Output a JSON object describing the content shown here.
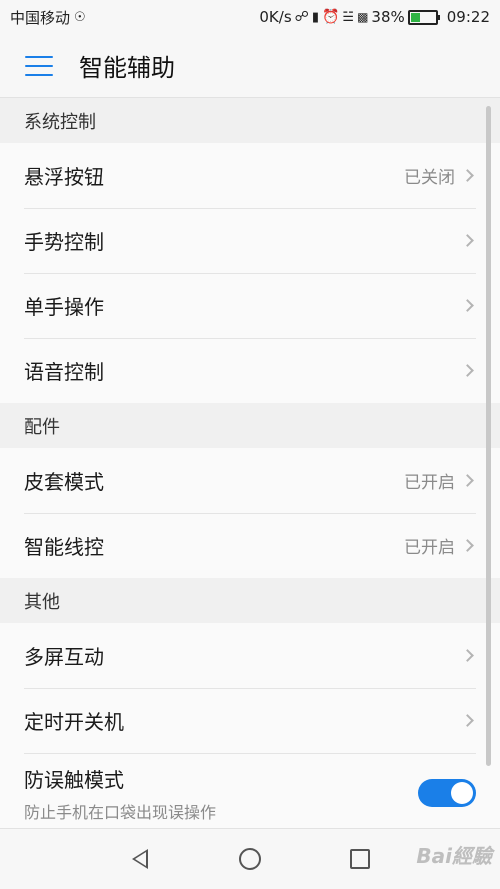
{
  "status_bar": {
    "carrier": "中国移动",
    "network_speed": "0K/s",
    "battery_percent": "38%",
    "battery_level": 0.38,
    "time": "09:22",
    "icons": [
      "hd-icon",
      "headphone-icon",
      "vibrate-icon",
      "alarm-icon",
      "wifi-icon",
      "4g-signal-icon",
      "battery-charging-icon"
    ]
  },
  "app_bar": {
    "title": "智能辅助",
    "menu_icon": "hamburger-menu-icon"
  },
  "sections": [
    {
      "header": "系统控制",
      "items": [
        {
          "label": "悬浮按钮",
          "status": "已关闭"
        },
        {
          "label": "手势控制",
          "status": ""
        },
        {
          "label": "单手操作",
          "status": ""
        },
        {
          "label": "语音控制",
          "status": ""
        }
      ]
    },
    {
      "header": "配件",
      "items": [
        {
          "label": "皮套模式",
          "status": "已开启"
        },
        {
          "label": "智能线控",
          "status": "已开启"
        }
      ]
    },
    {
      "header": "其他",
      "items": [
        {
          "label": "多屏互动",
          "status": ""
        },
        {
          "label": "定时开关机",
          "status": ""
        },
        {
          "label": "防误触模式",
          "subtitle": "防止手机在口袋出现误操作",
          "toggle_on": true
        }
      ]
    }
  ],
  "nav_bar": {
    "icons": [
      "back-triangle-icon",
      "home-circle-icon",
      "recent-apps-square-icon"
    ]
  },
  "watermark": "Bai經驗",
  "colors": {
    "accent": "#1a7fe8",
    "section_bg": "#f0f0f0",
    "secondary_text": "#8a8a8a"
  }
}
